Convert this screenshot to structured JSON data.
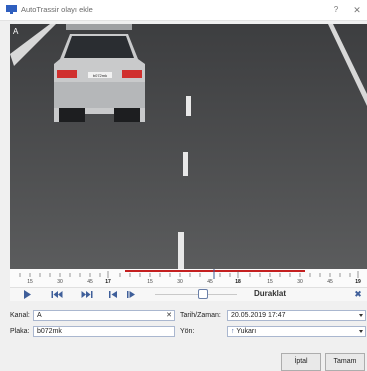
{
  "window": {
    "title": "AutoTrassir olayı ekle",
    "help_glyph": "?",
    "close_glyph": "✕"
  },
  "video": {
    "camera_label": "A",
    "plate_on_car": "b072mk"
  },
  "timeline": {
    "tick_labels": [
      "15",
      "30",
      "45",
      "17",
      "15",
      "30",
      "45",
      "18",
      "15",
      "30",
      "45",
      "19"
    ],
    "major_labels": [
      "17",
      "18",
      "19"
    ]
  },
  "controls": {
    "status": "Duraklat",
    "buttons": [
      "play-icon",
      "skip-start-icon",
      "skip-end-icon",
      "step-back-icon",
      "step-forward-icon"
    ]
  },
  "form": {
    "channel_label": "Kanal:",
    "channel_value": "A",
    "plate_label": "Plaka:",
    "plate_value": "b072mk",
    "datetime_label": "Tarih/Zaman:",
    "datetime_value": "20.05.2019 17:47",
    "direction_label": "Yön:",
    "direction_value": "Yukarı",
    "direction_icon": "arrow-up-icon"
  },
  "buttons": {
    "cancel": "İptal",
    "ok": "Tamam"
  },
  "colors": {
    "accent": "#3f5f9a",
    "timeline_range": "#c41f1f",
    "titlebar_icon": "#2f5fbf"
  }
}
